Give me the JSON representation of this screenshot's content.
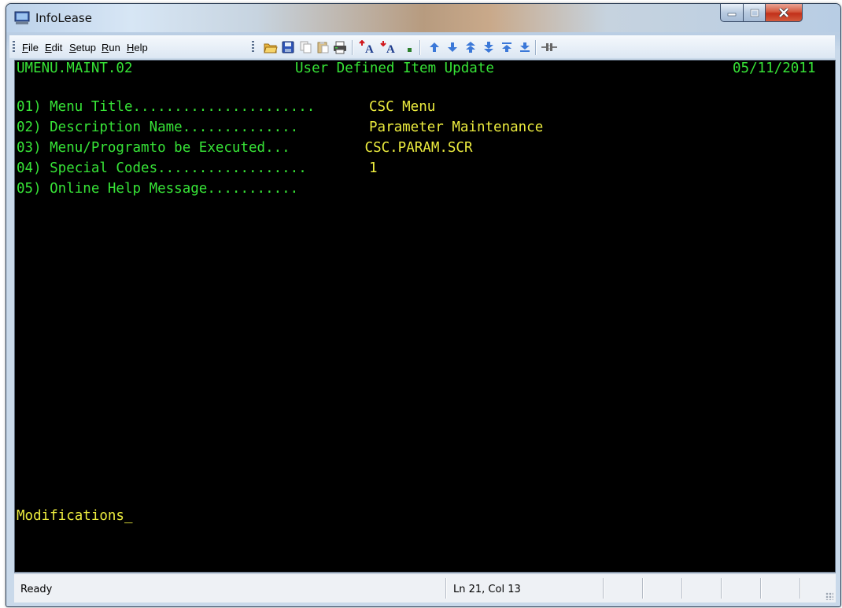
{
  "window": {
    "title": "InfoLease"
  },
  "menu": [
    "File",
    "Edit",
    "Setup",
    "Run",
    "Help"
  ],
  "toolbar": {
    "icons": [
      "open-icon",
      "save-icon",
      "copy-icon",
      "paste-icon",
      "print-icon",
      "font-larger-icon",
      "font-smaller-icon",
      "small-square-icon",
      "arrow-up-icon",
      "arrow-down-icon",
      "page-up-icon",
      "page-down-icon",
      "top-icon",
      "bottom-icon",
      "disconnect-icon"
    ]
  },
  "terminal": {
    "screen_id": "UMENU.MAINT.02",
    "screen_title": "User Defined Item Update",
    "date": "05/11/2011",
    "fields": [
      {
        "label": "01) Menu Title......................",
        "value": "CSC Menu"
      },
      {
        "label": "02) Description Name..............",
        "value": "Parameter Maintenance"
      },
      {
        "label": "03) Menu/Programto be Executed...",
        "value": " CSC.PARAM.SCR"
      },
      {
        "label": "04) Special Codes..................",
        "value": "1"
      },
      {
        "label": "05) Online Help Message...........",
        "value": ""
      }
    ],
    "prompt": "Modifications_"
  },
  "status": {
    "left": "Ready",
    "position": "Ln 21, Col 13"
  },
  "colors": {
    "terminal_bg": "#000000",
    "text_green": "#37e437",
    "text_yellow": "#ecec3e"
  }
}
